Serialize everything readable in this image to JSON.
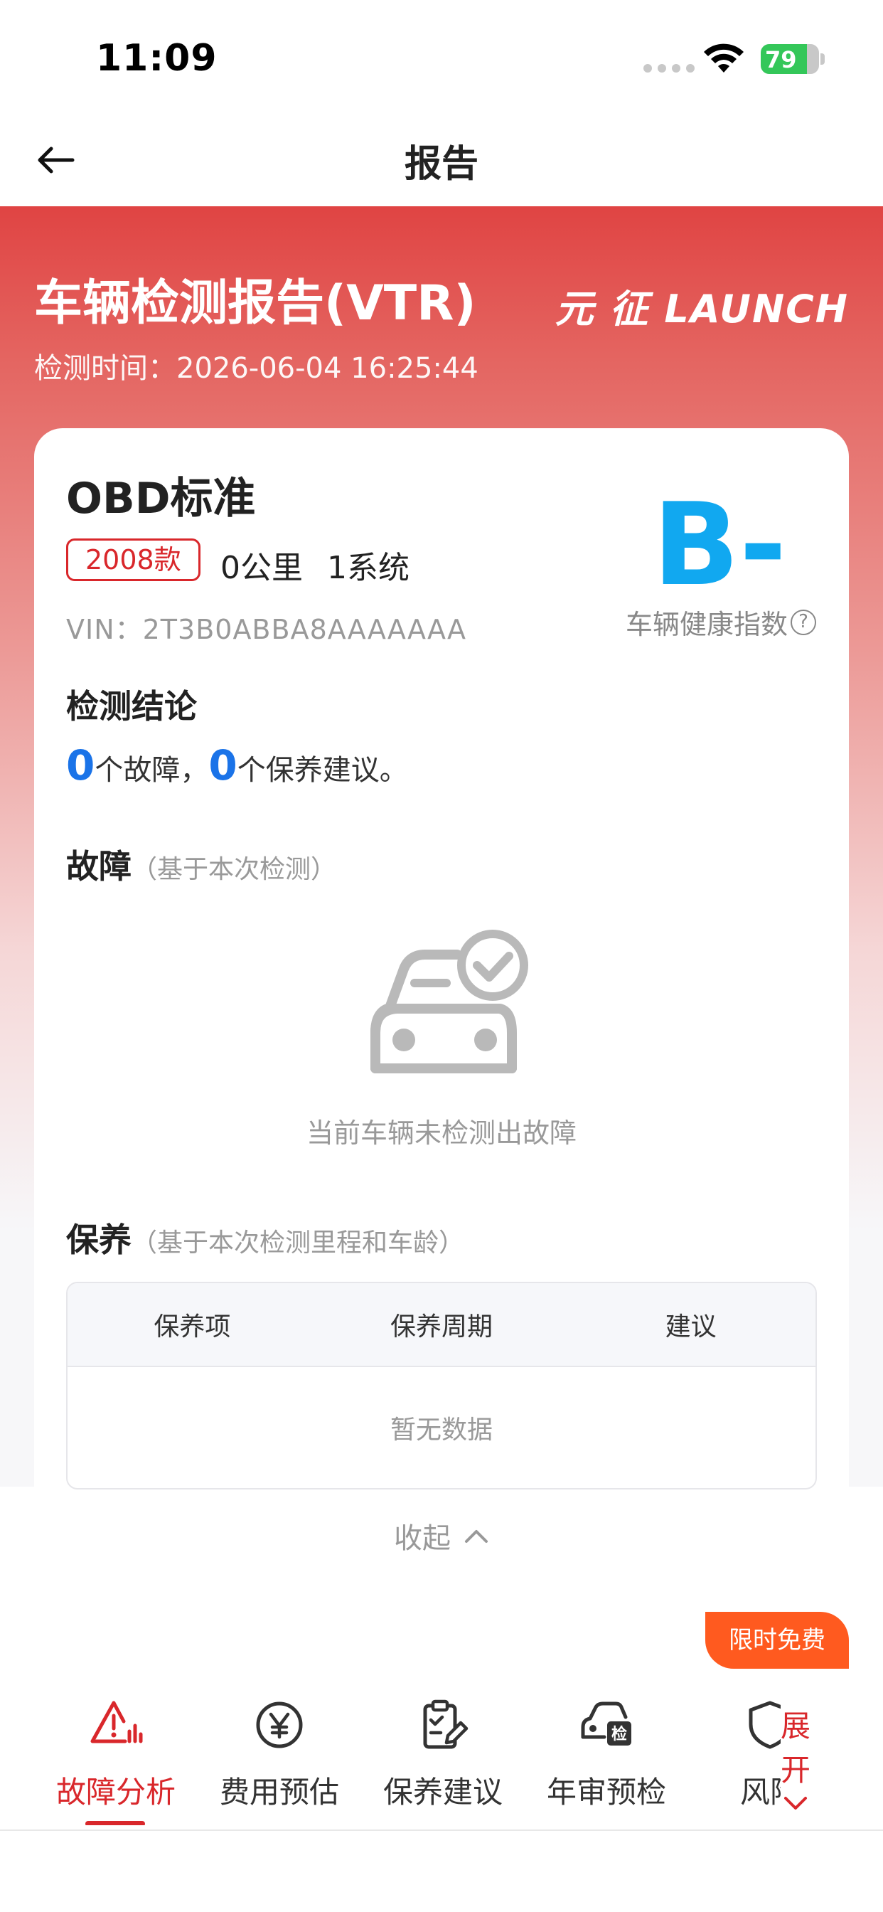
{
  "status_bar": {
    "time": "11:09",
    "battery_percent": 79
  },
  "nav": {
    "title": "报告"
  },
  "header": {
    "title": "车辆检测报告(VTR)",
    "time_label": "检测时间：2026-06-04 16:25:44",
    "brand": "元 征 LAUNCH"
  },
  "vehicle": {
    "name": "OBD标准",
    "year": "2008款",
    "mileage": "0公里",
    "systems": "1系统",
    "vin": "VIN：2T3B0ABBA8AAAAAAA",
    "grade": "B-",
    "health_label": "车辆健康指数",
    "help": "?"
  },
  "conclusion": {
    "title": "检测结论",
    "fault_count": "0",
    "fault_text": "个故障，",
    "maint_count": "0",
    "maint_text": "个保养建议。"
  },
  "fault": {
    "title": "故障",
    "subtitle": "（基于本次检测）",
    "empty_text": "当前车辆未检测出故障"
  },
  "maintenance": {
    "title": "保养",
    "subtitle": "（基于本次检测里程和车龄）",
    "columns": [
      "保养项",
      "保养周期",
      "建议"
    ],
    "empty_text": "暂无数据"
  },
  "collapse_label": "收起",
  "badge": "限时免费",
  "tabs": [
    {
      "label": "故障分析",
      "icon": "warning-chart-icon",
      "active": true
    },
    {
      "label": "费用预估",
      "icon": "yen-coin-icon",
      "active": false
    },
    {
      "label": "保养建议",
      "icon": "clipboard-pen-icon",
      "active": false
    },
    {
      "label": "年审预检",
      "icon": "car-inspection-icon",
      "active": false
    },
    {
      "label": "风险",
      "icon": "shield-icon",
      "active": false
    }
  ],
  "expand_label": "展开",
  "colors": {
    "brand_red": "#d9272b",
    "grade_blue": "#11a8f0",
    "link_blue": "#1a73e8",
    "badge_orange": "#ff5a1f"
  }
}
